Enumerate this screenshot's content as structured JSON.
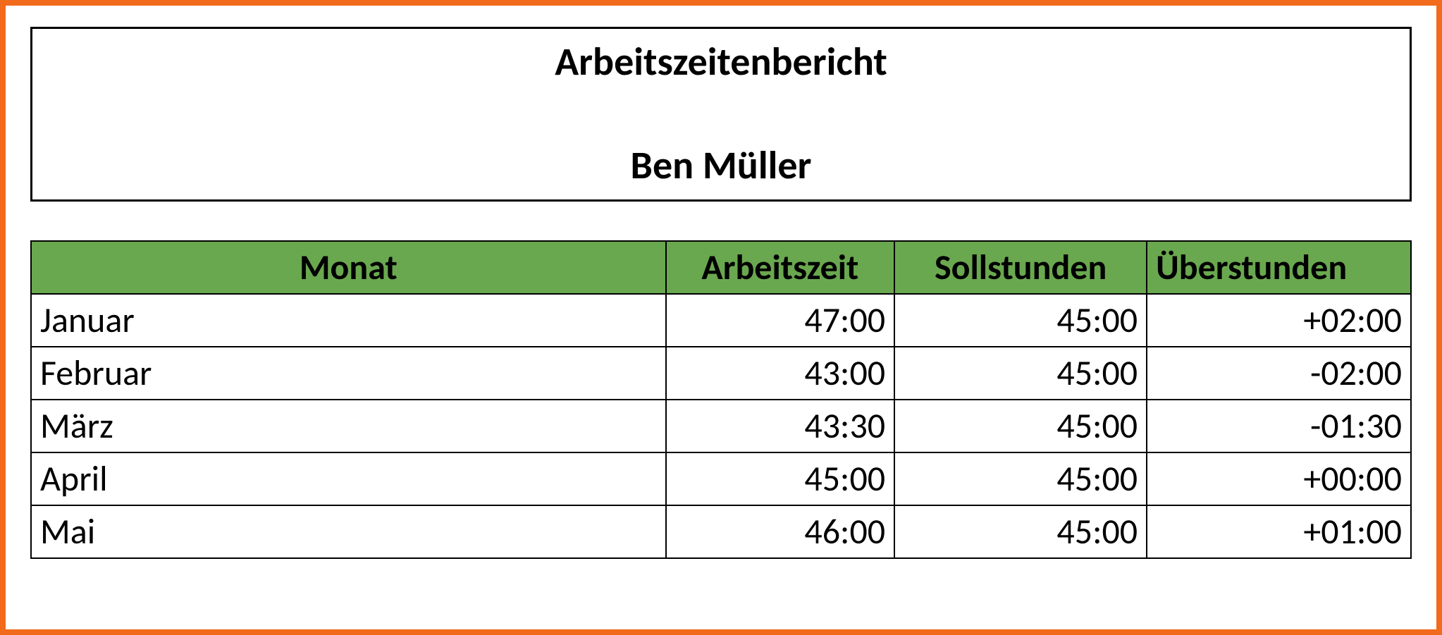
{
  "header": {
    "title": "Arbeitszeitenbericht",
    "name": "Ben Müller"
  },
  "table": {
    "columns": {
      "monat": "Monat",
      "arbeitszeit": "Arbeitszeit",
      "sollstunden": "Sollstunden",
      "ueberstunden": "Überstunden"
    },
    "rows": [
      {
        "month": "Januar",
        "arbeitszeit": "47:00",
        "sollstunden": "45:00",
        "ueberstunden": "+02:00"
      },
      {
        "month": "Februar",
        "arbeitszeit": "43:00",
        "sollstunden": "45:00",
        "ueberstunden": "-02:00"
      },
      {
        "month": "März",
        "arbeitszeit": "43:30",
        "sollstunden": "45:00",
        "ueberstunden": "-01:30"
      },
      {
        "month": "April",
        "arbeitszeit": "45:00",
        "sollstunden": "45:00",
        "ueberstunden": "+00:00"
      },
      {
        "month": "Mai",
        "arbeitszeit": "46:00",
        "sollstunden": "45:00",
        "ueberstunden": "+01:00"
      }
    ]
  }
}
